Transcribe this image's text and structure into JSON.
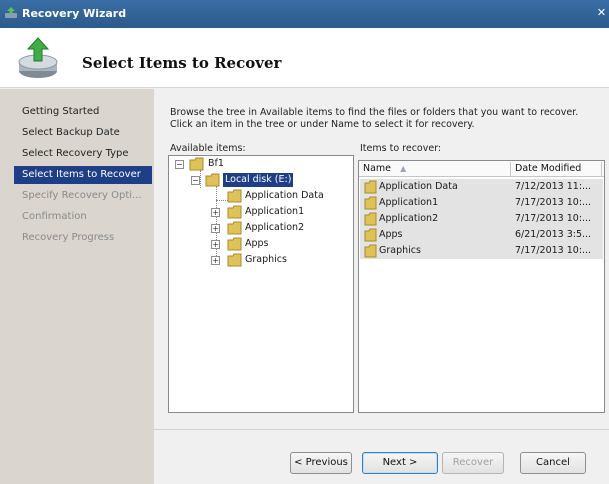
{
  "window": {
    "title": "Recovery Wizard"
  },
  "header": {
    "title": "Select Items to Recover"
  },
  "nav": {
    "items": [
      {
        "label": "Getting Started",
        "state": "normal"
      },
      {
        "label": "Select Backup Date",
        "state": "normal"
      },
      {
        "label": "Select Recovery Type",
        "state": "normal"
      },
      {
        "label": "Select Items to Recover",
        "state": "selected"
      },
      {
        "label": "Specify Recovery Opti...",
        "state": "disabled"
      },
      {
        "label": "Confirmation",
        "state": "disabled"
      },
      {
        "label": "Recovery Progress",
        "state": "disabled"
      }
    ]
  },
  "main": {
    "description": "Browse the tree in Available items to find the files or folders that you want to recover. Click an item in the tree or under Name to select it for recovery.",
    "available_label": "Available items:",
    "recover_label": "Items to recover:"
  },
  "tree": {
    "root": "Bf1",
    "disk": "Local disk (E:)",
    "children": [
      "Application Data",
      "Application1",
      "Application2",
      "Apps",
      "Graphics"
    ]
  },
  "list": {
    "columns": {
      "name": "Name",
      "date": "Date Modified"
    },
    "rows": [
      {
        "name": "Application Data",
        "date": "7/12/2013 11:..."
      },
      {
        "name": "Application1",
        "date": "7/17/2013 10:..."
      },
      {
        "name": "Application2",
        "date": "7/17/2013 10:..."
      },
      {
        "name": "Apps",
        "date": "6/21/2013 3:5..."
      },
      {
        "name": "Graphics",
        "date": "7/17/2013 10:..."
      }
    ]
  },
  "buttons": {
    "previous": "< Previous",
    "next": "Next >",
    "recover": "Recover",
    "cancel": "Cancel"
  },
  "colors": {
    "titlebar": "#3a6ea5",
    "selection": "#1e3f87",
    "nav_background": "#dad6cf"
  }
}
